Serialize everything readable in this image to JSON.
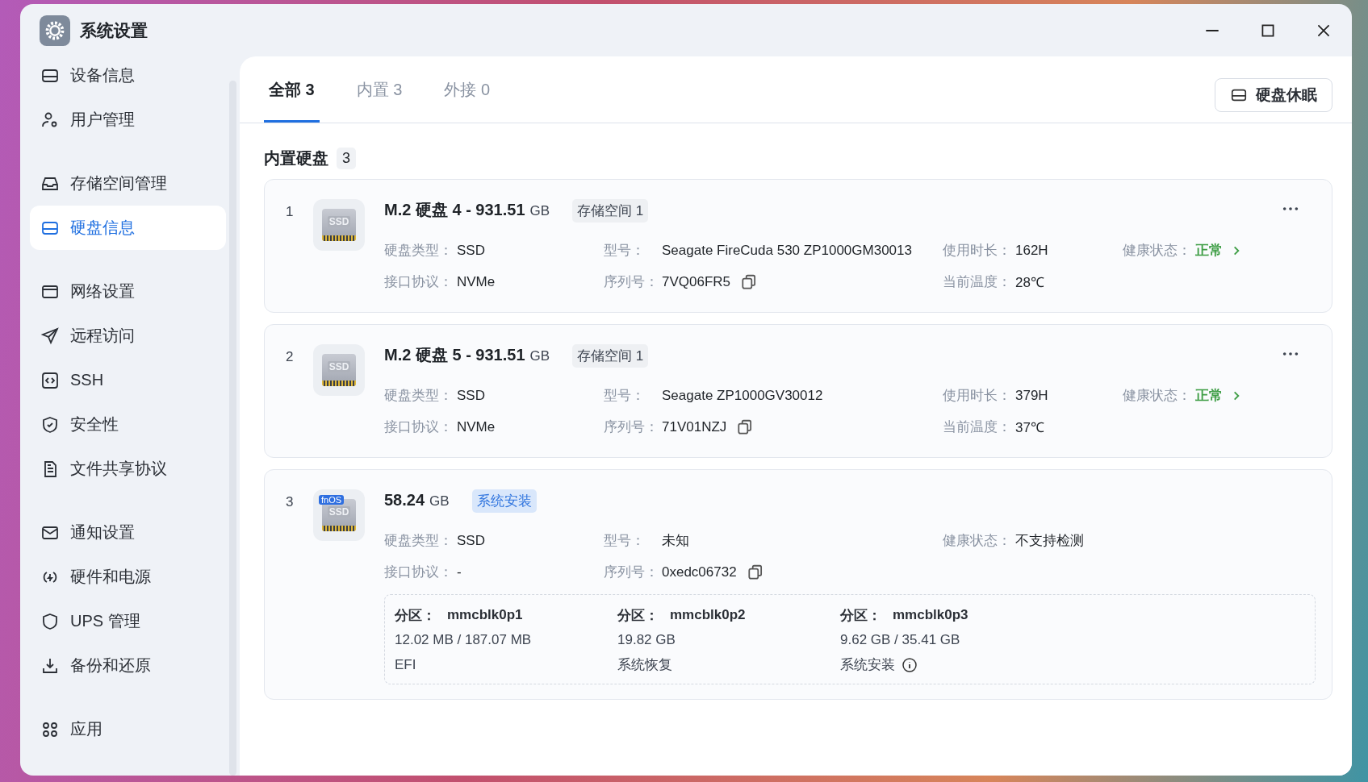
{
  "window": {
    "title": "系统设置"
  },
  "sidebar": {
    "groups": [
      {
        "items": [
          {
            "label": "设备信息",
            "selected": false
          },
          {
            "label": "用户管理",
            "selected": false
          }
        ]
      },
      {
        "items": [
          {
            "label": "存储空间管理",
            "selected": false
          },
          {
            "label": "硬盘信息",
            "selected": true
          }
        ]
      },
      {
        "items": [
          {
            "label": "网络设置",
            "selected": false
          },
          {
            "label": "远程访问",
            "selected": false
          },
          {
            "label": "SSH",
            "selected": false
          },
          {
            "label": "安全性",
            "selected": false
          },
          {
            "label": "文件共享协议",
            "selected": false
          }
        ]
      },
      {
        "items": [
          {
            "label": "通知设置",
            "selected": false
          },
          {
            "label": "硬件和电源",
            "selected": false
          },
          {
            "label": "UPS 管理",
            "selected": false
          },
          {
            "label": "备份和还原",
            "selected": false
          }
        ]
      },
      {
        "items": [
          {
            "label": "应用",
            "selected": false
          }
        ]
      }
    ]
  },
  "tabs": [
    {
      "label": "全部 3",
      "selected": true
    },
    {
      "label": "内置 3",
      "selected": false
    },
    {
      "label": "外接 0",
      "selected": false
    }
  ],
  "sleep_button": {
    "label": "硬盘休眠"
  },
  "section": {
    "title": "内置硬盘",
    "count": "3"
  },
  "disks": [
    {
      "index": "1",
      "icon_label": "SSD",
      "name": "M.2 硬盘 4 - 931.51",
      "unit": "GB",
      "tag": {
        "text": "存储空间 1",
        "kind": "pool"
      },
      "more": true,
      "rows": [
        [
          {
            "label": "硬盘类型：",
            "value": "SSD",
            "kind": "text"
          },
          {
            "label": "型号：",
            "value": "Seagate FireCuda 530 ZP1000GM30013",
            "kind": "text"
          },
          {
            "label": "使用时长：",
            "value": "162H",
            "kind": "text"
          },
          {
            "label": "健康状态：",
            "value": "正常",
            "kind": "status"
          }
        ],
        [
          {
            "label": "接口协议：",
            "value": "NVMe",
            "kind": "text"
          },
          {
            "label": "序列号：",
            "value": "7VQ06FR5",
            "kind": "copy"
          },
          {
            "label": "当前温度：",
            "value": "28℃",
            "kind": "text"
          }
        ]
      ]
    },
    {
      "index": "2",
      "icon_label": "SSD",
      "name": "M.2 硬盘 5 - 931.51",
      "unit": "GB",
      "tag": {
        "text": "存储空间 1",
        "kind": "pool"
      },
      "more": true,
      "rows": [
        [
          {
            "label": "硬盘类型：",
            "value": "SSD",
            "kind": "text"
          },
          {
            "label": "型号：",
            "value": "Seagate ZP1000GV30012",
            "kind": "text"
          },
          {
            "label": "使用时长：",
            "value": "379H",
            "kind": "text"
          },
          {
            "label": "健康状态：",
            "value": "正常",
            "kind": "status"
          }
        ],
        [
          {
            "label": "接口协议：",
            "value": "NVMe",
            "kind": "text"
          },
          {
            "label": "序列号：",
            "value": "71V01NZJ",
            "kind": "copy"
          },
          {
            "label": "当前温度：",
            "value": "37℃",
            "kind": "text"
          }
        ]
      ]
    },
    {
      "index": "3",
      "icon_label": "SSD",
      "icon_badge": "fnOS",
      "name": "58.24",
      "unit": "GB",
      "tag": {
        "text": "系统安装",
        "kind": "system"
      },
      "more": false,
      "rows": [
        [
          {
            "label": "硬盘类型：",
            "value": "SSD",
            "kind": "text"
          },
          {
            "label": "型号：",
            "value": "未知",
            "kind": "text"
          },
          {
            "label": "健康状态：",
            "value": "不支持检测",
            "kind": "text"
          }
        ],
        [
          {
            "label": "接口协议：",
            "value": "-",
            "kind": "text"
          },
          {
            "label": "序列号：",
            "value": "0xedc06732",
            "kind": "copy"
          }
        ]
      ],
      "partitions": [
        {
          "title": "分区：",
          "name": "mmcblk0p1",
          "size": "12.02 MB / 187.07 MB",
          "purpose": "EFI",
          "info": false
        },
        {
          "title": "分区：",
          "name": "mmcblk0p2",
          "size": "19.82 GB",
          "purpose": "系统恢复",
          "info": false
        },
        {
          "title": "分区：",
          "name": "mmcblk0p3",
          "size": "9.62 GB / 35.41 GB",
          "purpose": "系统安装",
          "info": true
        }
      ]
    }
  ]
}
